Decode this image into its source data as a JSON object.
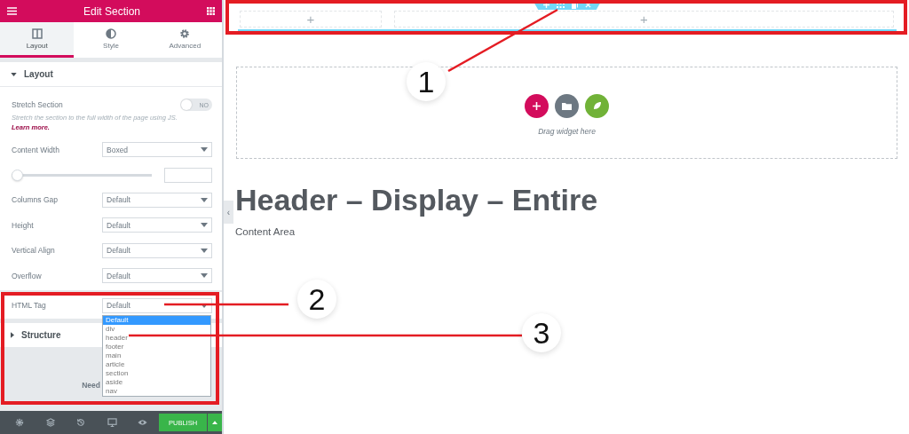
{
  "panel": {
    "title": "Edit Section",
    "tabs": [
      {
        "label": "Layout",
        "selected": true,
        "kind": "columns"
      },
      {
        "label": "Style",
        "selected": false,
        "kind": "contrast"
      },
      {
        "label": "Advanced",
        "selected": false,
        "kind": "gear"
      }
    ],
    "layout_section": {
      "title": "Layout",
      "expanded": true
    },
    "stretch": {
      "label": "Stretch Section",
      "toggle": "NO",
      "on": false,
      "help": "Stretch the section to the full width of the page using JS.",
      "link": "Learn more."
    },
    "content_width": {
      "label": "Content Width",
      "value": "Boxed",
      "level": 0
    },
    "controls": [
      {
        "label": "Columns Gap",
        "value": "Default"
      },
      {
        "label": "Height",
        "value": "Default"
      },
      {
        "label": "Vertical Align",
        "value": "Default"
      },
      {
        "label": "Overflow",
        "value": "Default"
      }
    ],
    "html_tag": {
      "label": "HTML Tag",
      "value": "Default",
      "open": true,
      "options": [
        {
          "label": "Default",
          "selected": true
        },
        {
          "label": "div",
          "selected": false
        },
        {
          "label": "header",
          "selected": false
        },
        {
          "label": "footer",
          "selected": false
        },
        {
          "label": "main",
          "selected": false
        },
        {
          "label": "article",
          "selected": false
        },
        {
          "label": "section",
          "selected": false
        },
        {
          "label": "aside",
          "selected": false
        },
        {
          "label": "nav",
          "selected": false
        }
      ]
    },
    "structure_section": {
      "title": "Structure",
      "expanded": false
    },
    "help_text": "Need",
    "footer": {
      "publish": "PUBLISH"
    }
  },
  "canvas": {
    "columns": [
      {
        "add": "+"
      },
      {
        "add": "+"
      }
    ],
    "drop_zone": {
      "hint": "Drag widget here"
    },
    "collapse": "‹",
    "heading": "Header – Display – Entire",
    "text": "Content Area"
  },
  "annotations": [
    {
      "number": "1"
    },
    {
      "number": "2"
    },
    {
      "number": "3"
    }
  ]
}
